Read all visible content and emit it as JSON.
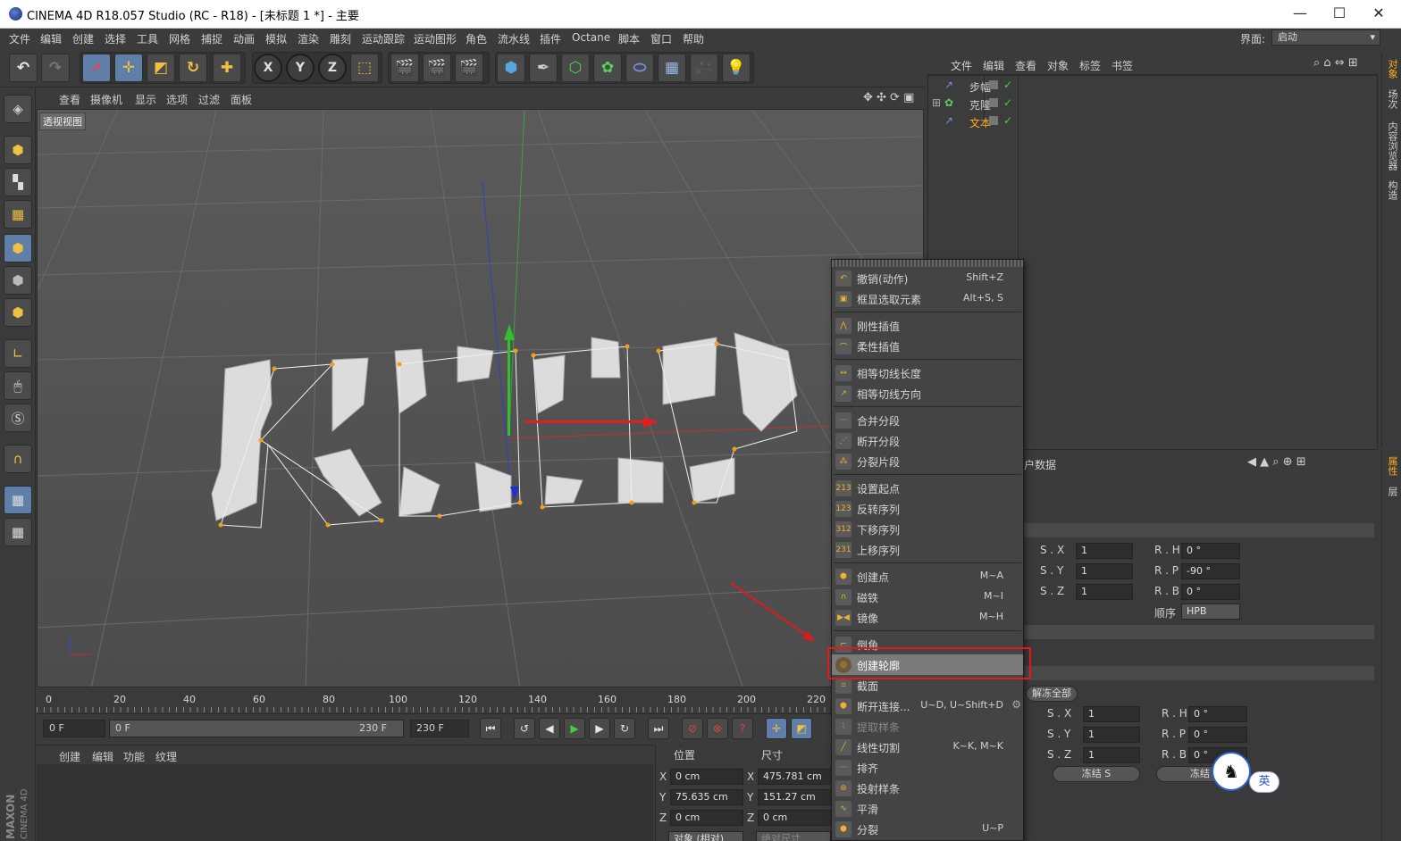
{
  "window": {
    "title": "CINEMA 4D R18.057 Studio (RC - R18) - [未标题 1 *] - 主要",
    "minimize": "—",
    "maximize": "☐",
    "close": "✕"
  },
  "menubar": {
    "items": [
      "文件",
      "编辑",
      "创建",
      "选择",
      "工具",
      "网格",
      "捕捉",
      "动画",
      "模拟",
      "渲染",
      "雕刻",
      "运动跟踪",
      "运动图形",
      "角色",
      "流水线",
      "插件",
      "Octane",
      "脚本",
      "窗口",
      "帮助"
    ],
    "interface_label": "界面:",
    "interface_value": "启动"
  },
  "toolbar": {
    "axis_x": "X",
    "axis_y": "Y",
    "axis_z": "Z"
  },
  "viewport": {
    "menu": [
      "查看",
      "摄像机",
      "显示",
      "选项",
      "过滤",
      "面板"
    ],
    "label": "透视视图",
    "text_object": "KEEP"
  },
  "timeline": {
    "ticks": [
      "0",
      "20",
      "40",
      "60",
      "80",
      "100",
      "120",
      "140",
      "160",
      "180",
      "200",
      "220"
    ],
    "current_frame": "0 F",
    "range_start": "0 F",
    "range_end": "230 F",
    "end_frame": "230 F"
  },
  "material": {
    "menu": [
      "创建",
      "编辑",
      "功能",
      "纹理"
    ]
  },
  "coords": {
    "position_header": "位置",
    "size_header": "尺寸",
    "rows": [
      {
        "axis": "X",
        "pos": "0 cm",
        "size_axis": "X",
        "size": "475.781 cm"
      },
      {
        "axis": "Y",
        "pos": "75.635 cm",
        "size_axis": "Y",
        "size": "151.27 cm"
      },
      {
        "axis": "Z",
        "pos": "0 cm",
        "size_axis": "Z",
        "size": "0 cm"
      }
    ],
    "mode_object": "对象 (相对)",
    "mode_size": "绝对尺寸"
  },
  "object_manager": {
    "menu": [
      "文件",
      "编辑",
      "查看",
      "对象",
      "标签",
      "书签"
    ],
    "objects": [
      {
        "name": "步幅",
        "selected": false
      },
      {
        "name": "克隆",
        "selected": false
      },
      {
        "name": "文本",
        "selected": true
      }
    ]
  },
  "right_tabs": [
    "对象",
    "场次",
    "内容浏览器",
    "构造"
  ],
  "attr_tabs": [
    "属性",
    "层"
  ],
  "attribute_manager": {
    "header": "户数据",
    "rows1": [
      {
        "s_label": "S . X",
        "s_val": "1",
        "r_label": "R . H",
        "r_val": "0 °"
      },
      {
        "s_label": "S . Y",
        "s_val": "1",
        "r_label": "R . P",
        "r_val": "-90 °"
      },
      {
        "s_label": "S . Z",
        "s_val": "1",
        "r_label": "R . B",
        "r_val": "0 °"
      }
    ],
    "order_label": "顺序",
    "order_value": "HPB",
    "unfreeze_all": "解冻全部",
    "rows2": [
      {
        "s_label": "S . X",
        "s_val": "1",
        "r_label": "R . H",
        "r_val": "0 °"
      },
      {
        "s_label": "S . Y",
        "s_val": "1",
        "r_label": "R . P",
        "r_val": "0 °"
      },
      {
        "s_label": "S . Z",
        "s_val": "1",
        "r_label": "R . B",
        "r_val": "0 °"
      }
    ],
    "freeze_s": "冻结 S",
    "freeze_t": "冻结"
  },
  "context_menu": {
    "items": [
      {
        "label": "撤销(动作)",
        "shortcut": "Shift+Z",
        "icon": "undo-icon"
      },
      {
        "label": "框显选取元素",
        "shortcut": "Alt+S, S",
        "icon": "frame-icon"
      },
      {
        "label": "刚性插值",
        "shortcut": "",
        "icon": "hard-interp-icon"
      },
      {
        "label": "柔性插值",
        "shortcut": "",
        "icon": "soft-interp-icon"
      },
      {
        "label": "相等切线长度",
        "shortcut": "",
        "icon": "tangent-length-icon"
      },
      {
        "label": "相等切线方向",
        "shortcut": "",
        "icon": "tangent-direction-icon"
      },
      {
        "label": "合并分段",
        "shortcut": "",
        "icon": "join-segment-icon"
      },
      {
        "label": "断开分段",
        "shortcut": "",
        "icon": "break-segment-icon"
      },
      {
        "label": "分裂片段",
        "shortcut": "",
        "icon": "explode-segment-icon"
      },
      {
        "label": "设置起点",
        "shortcut": "",
        "icon": "set-start-icon"
      },
      {
        "label": "反转序列",
        "shortcut": "",
        "icon": "reverse-sequence-icon"
      },
      {
        "label": "下移序列",
        "shortcut": "",
        "icon": "move-down-icon"
      },
      {
        "label": "上移序列",
        "shortcut": "",
        "icon": "move-up-icon"
      },
      {
        "label": "创建点",
        "shortcut": "M~A",
        "icon": "create-point-icon"
      },
      {
        "label": "磁铁",
        "shortcut": "M~I",
        "icon": "magnet-icon"
      },
      {
        "label": "镜像",
        "shortcut": "M~H",
        "icon": "mirror-icon"
      },
      {
        "label": "倒角",
        "shortcut": "",
        "icon": "chamfer-icon"
      },
      {
        "label": "创建轮廓",
        "shortcut": "",
        "icon": "outline-icon"
      },
      {
        "label": "截面",
        "shortcut": "",
        "icon": "cross-section-icon"
      },
      {
        "label": "断开连接...",
        "shortcut": "U~D, U~Shift+D",
        "icon": "disconnect-icon"
      },
      {
        "label": "提取样条",
        "shortcut": "",
        "icon": "extract-spline-icon"
      },
      {
        "label": "线性切割",
        "shortcut": "K~K, M~K",
        "icon": "knife-icon"
      },
      {
        "label": "排齐",
        "shortcut": "",
        "icon": "align-icon"
      },
      {
        "label": "投射样条",
        "shortcut": "",
        "icon": "project-spline-icon"
      },
      {
        "label": "平滑",
        "shortcut": "",
        "icon": "smooth-icon"
      },
      {
        "label": "分裂",
        "shortcut": "U~P",
        "icon": "split-icon"
      }
    ]
  },
  "ime_badge": "英"
}
